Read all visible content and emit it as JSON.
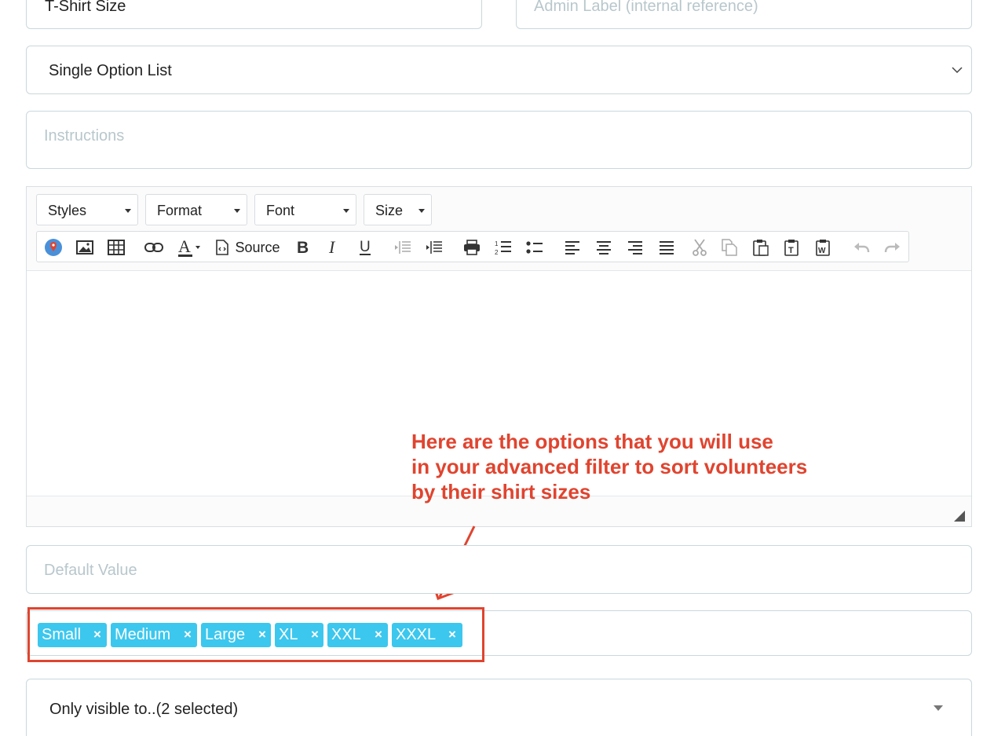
{
  "fields": {
    "name_value": "T-Shirt Size",
    "admin_label_placeholder": "Admin Label (internal reference)",
    "type_selected": "Single Option List",
    "instructions_placeholder": "Instructions",
    "default_value_placeholder": "Default Value",
    "visibility_selected": "Only visible to..(2 selected)"
  },
  "editor": {
    "dropdowns": [
      "Styles",
      "Format",
      "Font",
      "Size"
    ],
    "source_label": "Source",
    "toolbar_icons": [
      "map-icon",
      "image-icon",
      "table-icon",
      "link-icon",
      "text-color-icon",
      "source-icon",
      "bold-icon",
      "italic-icon",
      "underline-icon",
      "outdent-icon",
      "indent-icon",
      "print-icon",
      "numbered-list-icon",
      "bullet-list-icon",
      "align-left-icon",
      "align-center-icon",
      "align-right-icon",
      "justify-icon",
      "cut-icon",
      "copy-icon",
      "paste-icon",
      "paste-text-icon",
      "paste-word-icon",
      "undo-icon",
      "redo-icon"
    ]
  },
  "annotation": {
    "lines": [
      "Here are the options that you will use",
      "in your advanced filter to sort volunteers",
      "by their shirt sizes"
    ],
    "color": "#e0442f"
  },
  "options": {
    "tags": [
      "Small",
      "Medium",
      "Large",
      "XL",
      "XXL",
      "XXXL"
    ],
    "remove_symbol": "×",
    "tag_color": "#3cc7ee"
  }
}
